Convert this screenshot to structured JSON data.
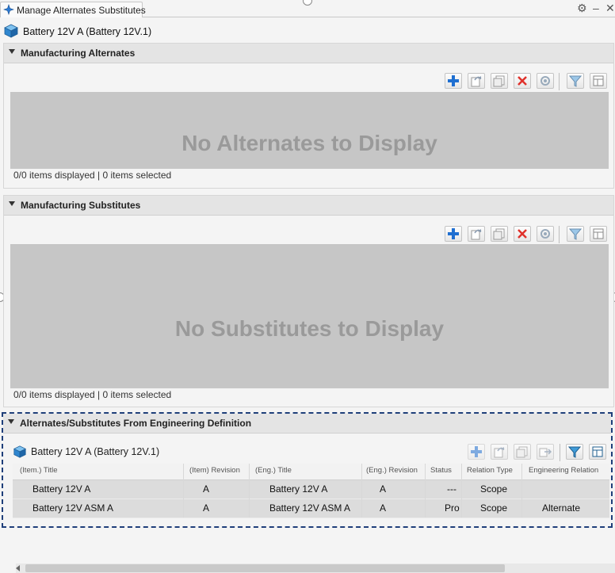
{
  "window": {
    "tab_title": "Manage Alternates Substitutes"
  },
  "product": {
    "label": "Battery 12V A (Battery 12V.1)"
  },
  "alternates": {
    "title": "Manufacturing Alternates",
    "empty_message": "No Alternates to Display",
    "status": "0/0 items displayed | 0 items selected"
  },
  "substitutes": {
    "title": "Manufacturing Substitutes",
    "empty_message": "No Substitutes to Display",
    "status": "0/0 items displayed | 0 items selected"
  },
  "engineering": {
    "title": "Alternates/Substitutes From Engineering Definition",
    "product_label": "Battery 12V A (Battery 12V.1)",
    "columns": [
      "(Item.) Title",
      "(Item) Revision",
      "(Eng.) Title",
      "(Eng.) Revision",
      "Status",
      "Relation Type",
      "Engineering Relation"
    ],
    "rows": [
      {
        "item_title": "Battery 12V A",
        "item_rev": "A",
        "eng_title": "Battery 12V A",
        "eng_rev": "A",
        "status": "---",
        "relation_type": "Scope",
        "eng_relation": ""
      },
      {
        "item_title": "Battery 12V ASM A",
        "item_rev": "A",
        "eng_title": "Battery 12V ASM A",
        "eng_rev": "A",
        "status": "Pro",
        "relation_type": "Scope",
        "eng_relation": "Alternate"
      }
    ]
  },
  "colors": {
    "accent_blue": "#1f6fd1",
    "delete_red": "#e0312b",
    "dashed_border": "#1f3f7a",
    "empty_grid": "#c6c6c6"
  }
}
